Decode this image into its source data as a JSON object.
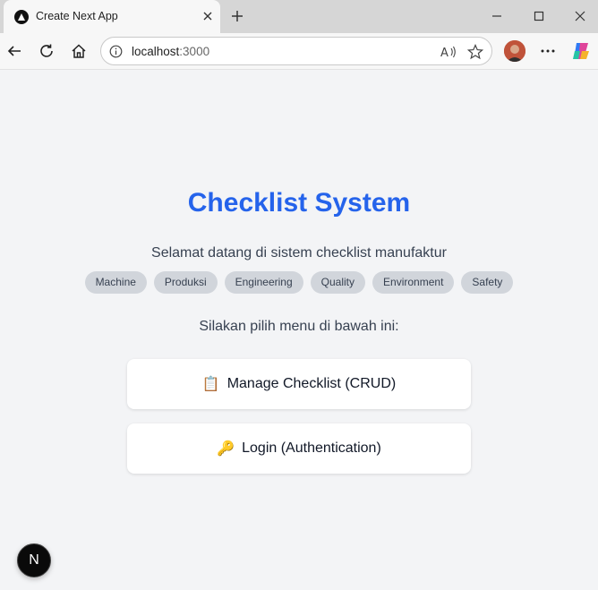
{
  "browser": {
    "tab_title": "Create Next App",
    "url_host": "localhost",
    "url_port": ":3000"
  },
  "page": {
    "title": "Checklist System",
    "subtitle": "Selamat datang di sistem checklist manufaktur",
    "tags": [
      "Machine",
      "Produksi",
      "Engineering",
      "Quality",
      "Environment",
      "Safety"
    ],
    "prompt": "Silakan pilih menu di bawah ini:",
    "menu": [
      {
        "icon": "📋",
        "label": "Manage Checklist (CRUD)"
      },
      {
        "icon": "🔑",
        "label": "Login (Authentication)"
      }
    ],
    "dev_badge": "N"
  },
  "colors": {
    "accent": "#2563eb",
    "page_bg": "#f3f4f6",
    "tag_bg": "#d1d5db"
  }
}
